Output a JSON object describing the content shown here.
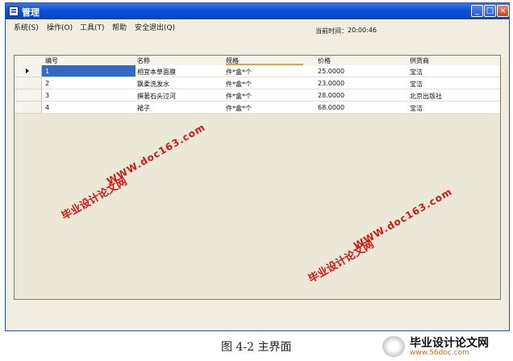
{
  "window": {
    "title": "管理"
  },
  "menu": [
    "系统(S)",
    "操作(O)",
    "工具(T)",
    "帮助",
    "安全退出(Q)"
  ],
  "clock": {
    "label": "当前时间：",
    "value": "20:00:46"
  },
  "grid": {
    "columns": [
      "编号",
      "名称",
      "规格",
      "价格",
      "供货商"
    ],
    "rows": [
      [
        "1",
        "相宜本草面膜",
        "件*盒*个",
        "25.0000",
        "宝洁"
      ],
      [
        "2",
        "飘柔洗发水",
        "件*盒*个",
        "23.0000",
        "宝洁"
      ],
      [
        "3",
        "撰著石头过河",
        "件*盒*个",
        "28.0000",
        "北京出版社"
      ],
      [
        "4",
        "裙子",
        "件*盒*个",
        "68.0000",
        "宝洁"
      ]
    ]
  },
  "watermarks": {
    "text_cn": "毕业设计论文网",
    "text_url": "WWW.doc163.com"
  },
  "caption": "图 4-2 主界面",
  "logo": {
    "main": "毕业设计论文网",
    "sub": "www.56doc.com"
  }
}
